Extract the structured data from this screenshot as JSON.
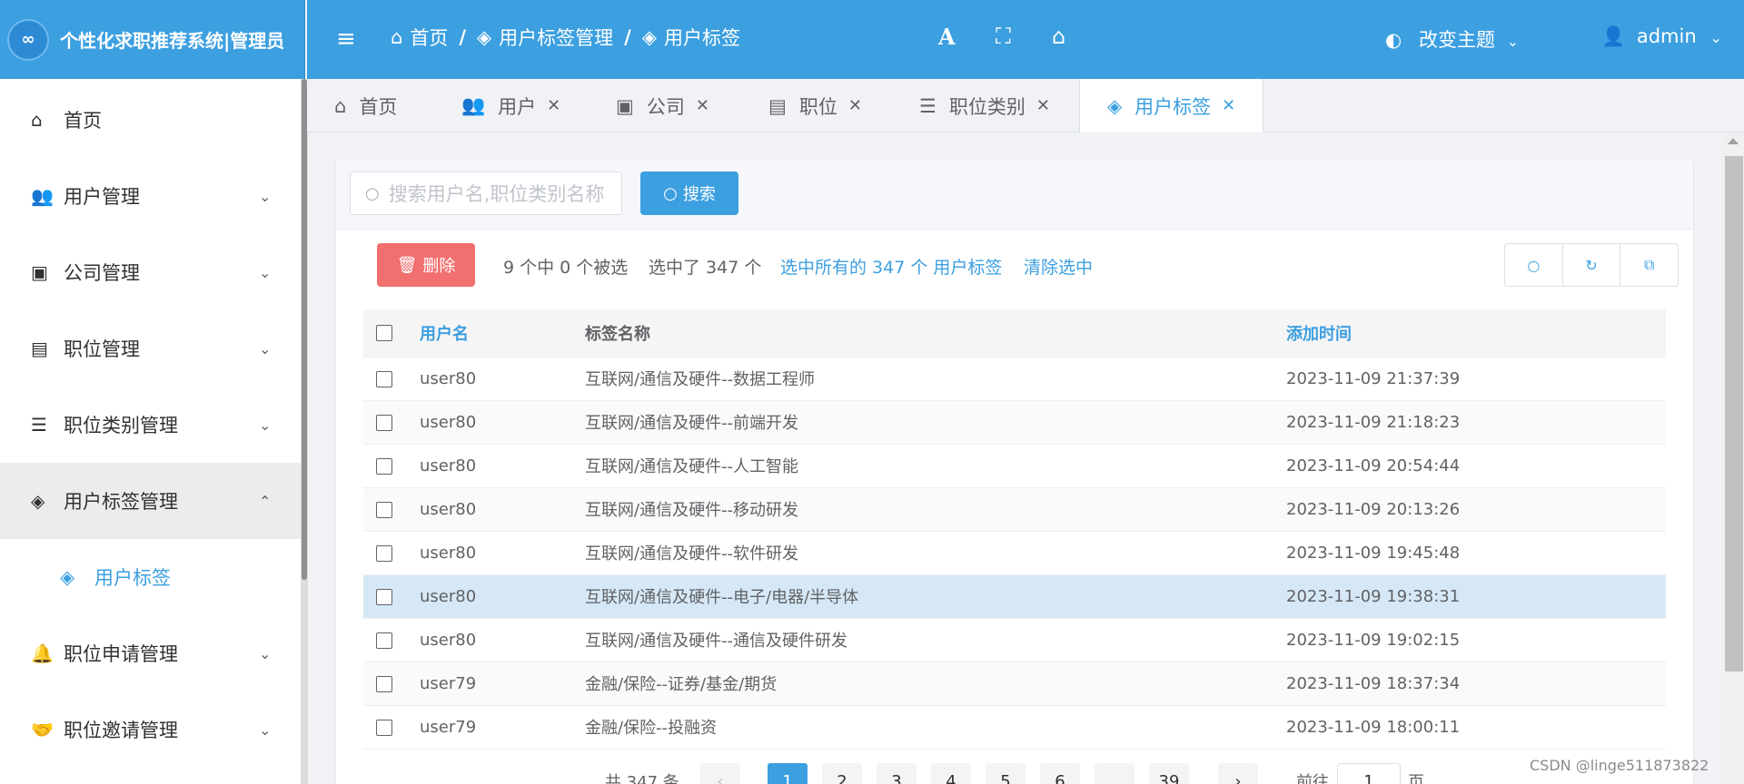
{
  "app": {
    "title": "个性化求职推荐系统|管理员",
    "logo_text": "∞"
  },
  "header": {
    "breadcrumb": [
      "首页",
      "用户标签管理",
      "用户标签"
    ],
    "theme_label": "改变主题",
    "user_label": "admin"
  },
  "sidebar": {
    "items": [
      {
        "label": "首页",
        "icon": "home-icon"
      },
      {
        "label": "用户管理",
        "icon": "users-icon"
      },
      {
        "label": "公司管理",
        "icon": "store-icon"
      },
      {
        "label": "职位管理",
        "icon": "archive-icon"
      },
      {
        "label": "职位类别管理",
        "icon": "list-icon"
      },
      {
        "label": "用户标签管理",
        "icon": "tags-icon"
      },
      {
        "label": "职位申请管理",
        "icon": "bell-icon"
      },
      {
        "label": "职位邀请管理",
        "icon": "handshake-icon"
      }
    ],
    "sub_item": {
      "label": "用户标签",
      "icon": "tags-icon"
    }
  },
  "tabs": [
    {
      "label": "首页",
      "icon": "home-icon"
    },
    {
      "label": "用户",
      "icon": "users-icon"
    },
    {
      "label": "公司",
      "icon": "store-icon"
    },
    {
      "label": "职位",
      "icon": "archive-icon"
    },
    {
      "label": "职位类别",
      "icon": "list-icon"
    },
    {
      "label": "用户标签",
      "icon": "tags-icon"
    }
  ],
  "toolbar": {
    "search_placeholder": "搜索用户名,职位类别名称",
    "search_button": "搜索",
    "delete_button": "删除",
    "selection_count": "9 个中 0 个被选",
    "selected_total": "选中了 347 个",
    "select_all_link": "选中所有的 347 个 用户标签",
    "clear_selection_link": "清除选中"
  },
  "table": {
    "columns": [
      "用户名",
      "标签名称",
      "添加时间"
    ],
    "rows": [
      {
        "user": "user80",
        "tag": "互联网/通信及硬件--数据工程师",
        "time": "2023-11-09 21:37:39"
      },
      {
        "user": "user80",
        "tag": "互联网/通信及硬件--前端开发",
        "time": "2023-11-09 21:18:23"
      },
      {
        "user": "user80",
        "tag": "互联网/通信及硬件--人工智能",
        "time": "2023-11-09 20:54:44"
      },
      {
        "user": "user80",
        "tag": "互联网/通信及硬件--移动研发",
        "time": "2023-11-09 20:13:26"
      },
      {
        "user": "user80",
        "tag": "互联网/通信及硬件--软件研发",
        "time": "2023-11-09 19:45:48"
      },
      {
        "user": "user80",
        "tag": "互联网/通信及硬件--电子/电器/半导体",
        "time": "2023-11-09 19:38:31"
      },
      {
        "user": "user80",
        "tag": "互联网/通信及硬件--通信及硬件研发",
        "time": "2023-11-09 19:02:15"
      },
      {
        "user": "user79",
        "tag": "金融/保险--证券/基金/期货",
        "time": "2023-11-09 18:37:34"
      },
      {
        "user": "user79",
        "tag": "金融/保险--投融资",
        "time": "2023-11-09 18:00:11"
      }
    ]
  },
  "pagination": {
    "total_text": "共 347 条",
    "pages": [
      "1",
      "2",
      "3",
      "4",
      "5",
      "6",
      "...",
      "39"
    ],
    "goto_prefix": "前往",
    "goto_value": "1",
    "goto_suffix": "页"
  },
  "watermark": "CSDN @linge511873822",
  "colors": {
    "primary": "#3c9fe0",
    "danger": "#f26f6f",
    "selected_row": "#d6e8f5"
  }
}
